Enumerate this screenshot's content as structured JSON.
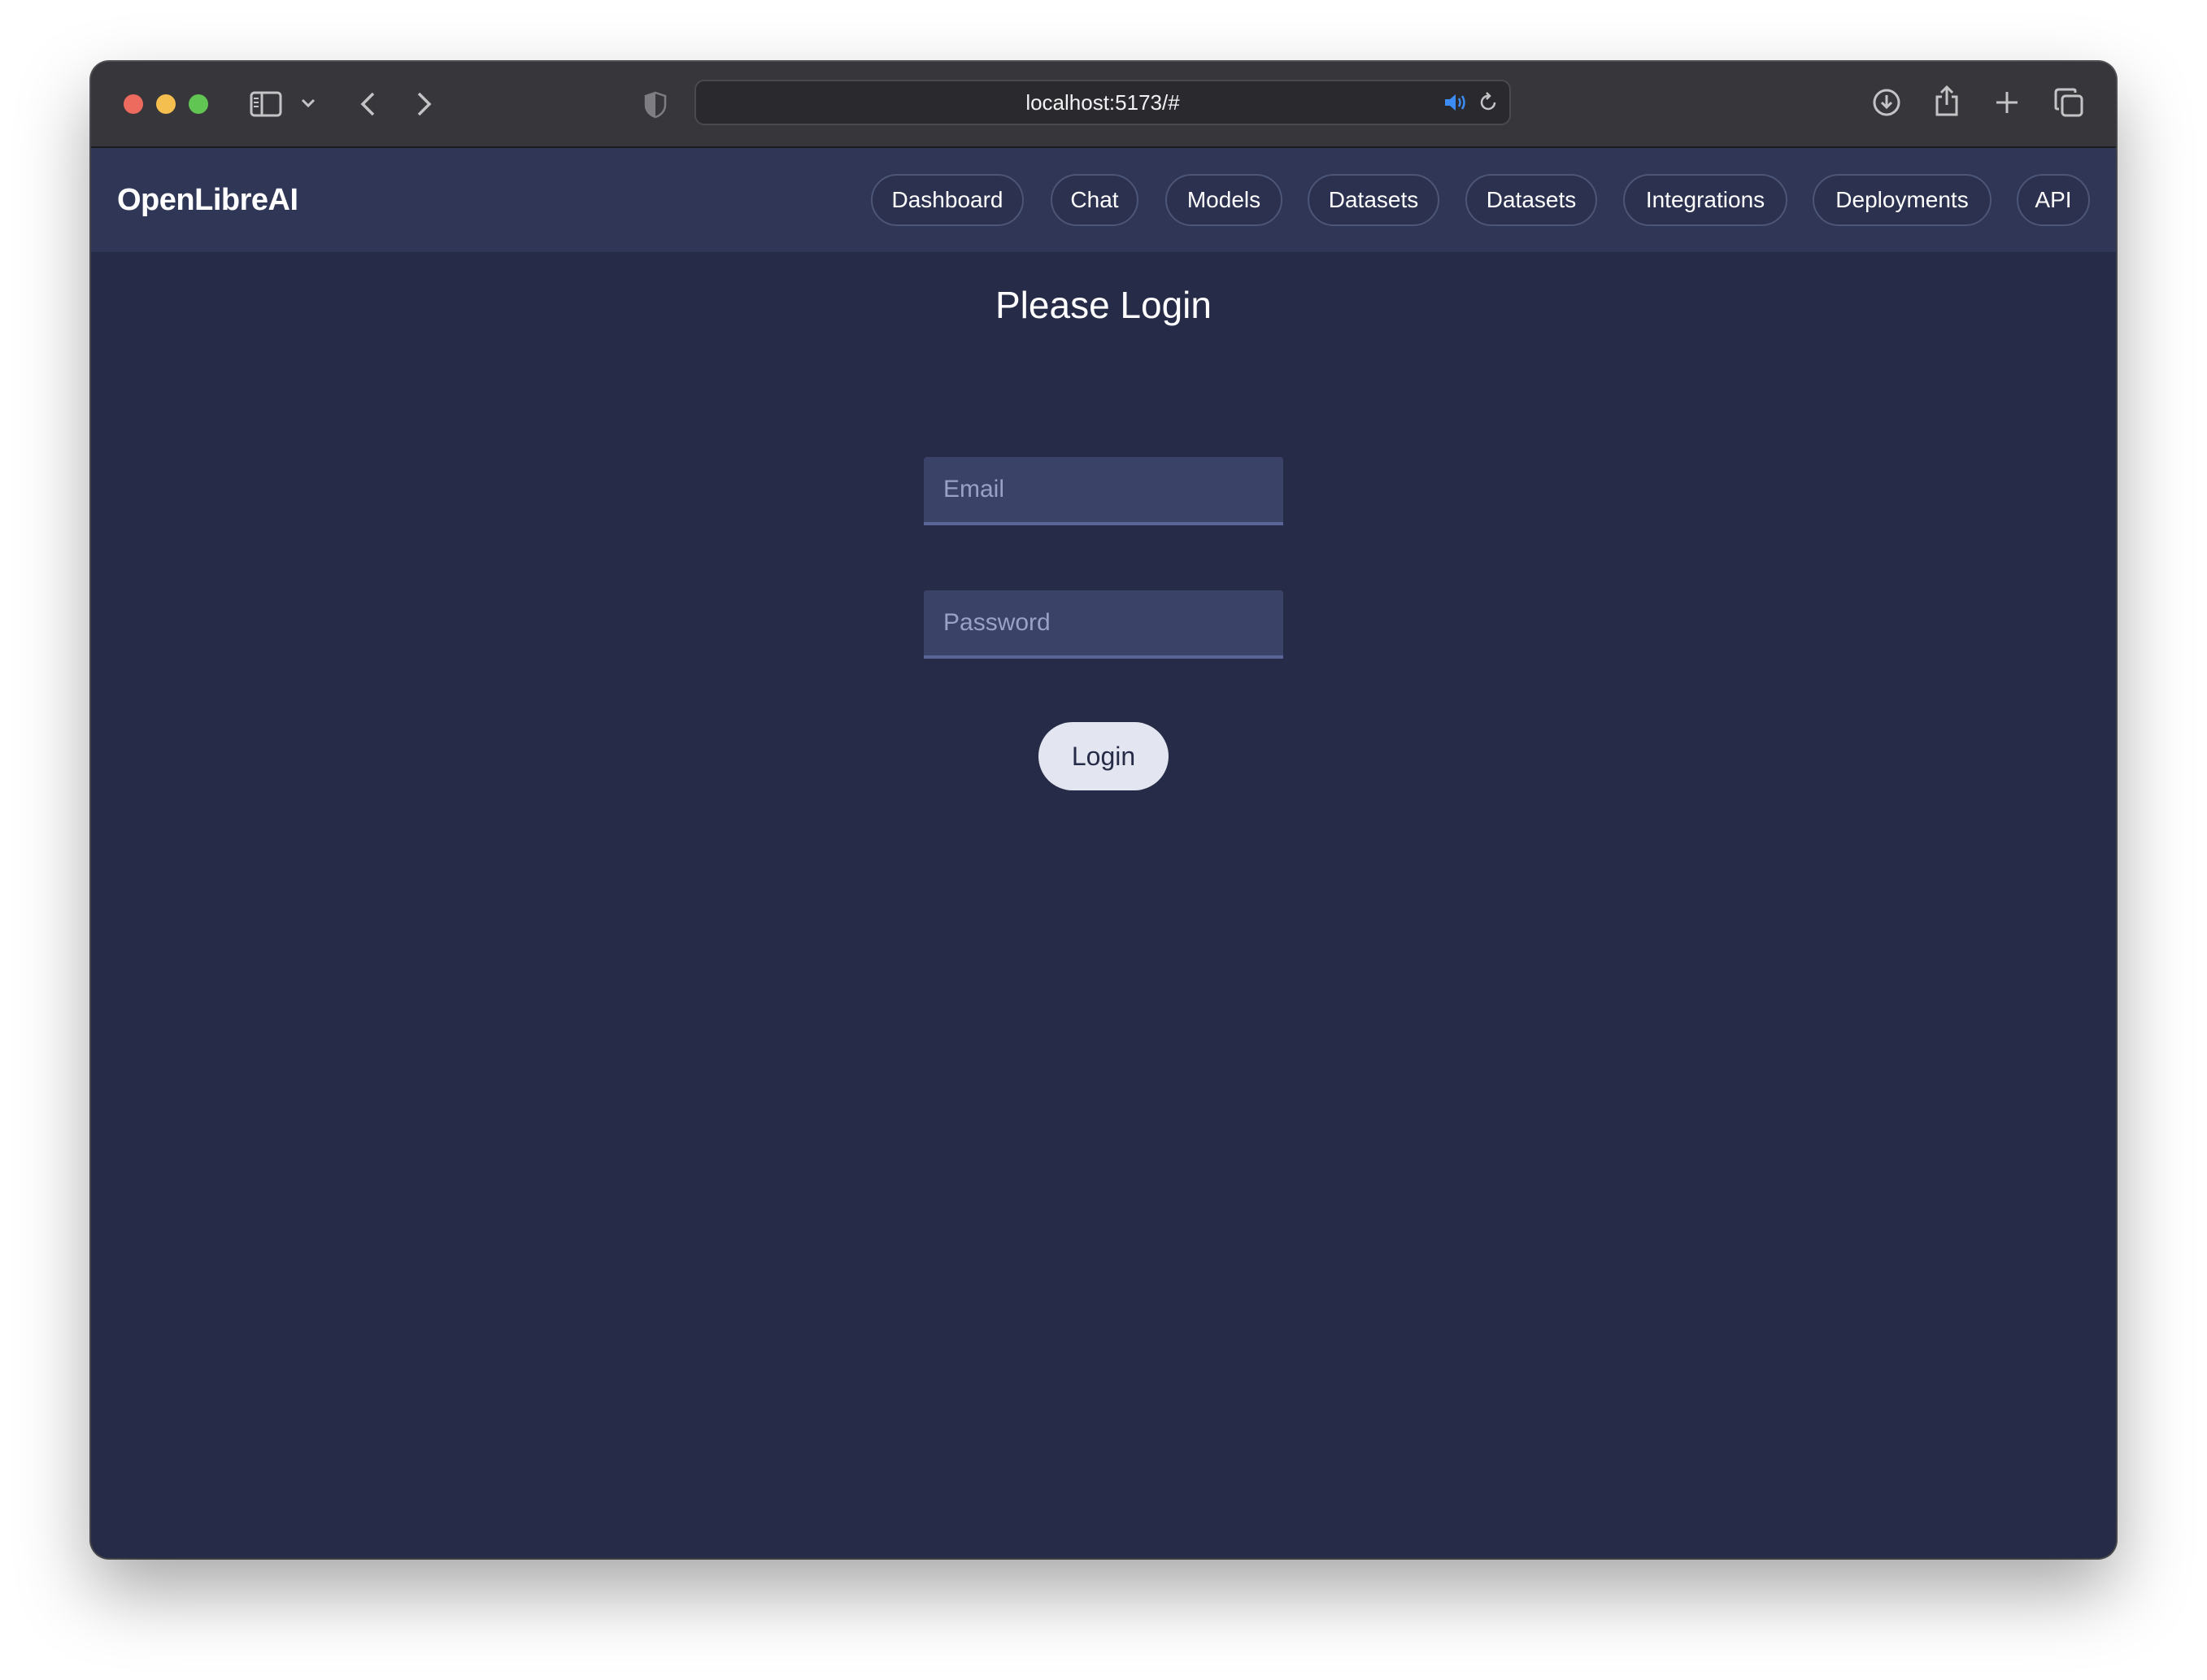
{
  "browser": {
    "url": "localhost:5173/#",
    "icons": [
      "sidebar-toggle-icon",
      "chevron-down-icon",
      "back-arrow-icon",
      "forward-arrow-icon",
      "shield-icon",
      "speaker-icon",
      "reload-icon",
      "download-icon",
      "share-icon",
      "plus-icon",
      "tabs-overview-icon"
    ]
  },
  "navbar": {
    "brand": "OpenLibreAI",
    "items": [
      {
        "label": "Dashboard"
      },
      {
        "label": "Chat"
      },
      {
        "label": "Models"
      },
      {
        "label": "Datasets"
      },
      {
        "label": "Datasets"
      },
      {
        "label": "Integrations"
      },
      {
        "label": "Deployments"
      },
      {
        "label": "API"
      }
    ]
  },
  "login": {
    "title": "Please Login",
    "email_placeholder": "Email",
    "email_value": "",
    "password_placeholder": "Password",
    "password_value": "",
    "button_label": "Login"
  },
  "colors": {
    "background": "#262b47",
    "navbar": "#2f3656",
    "input": "#3b4268",
    "button": "#e3e6f0",
    "accent_speaker": "#3b8cf5"
  }
}
